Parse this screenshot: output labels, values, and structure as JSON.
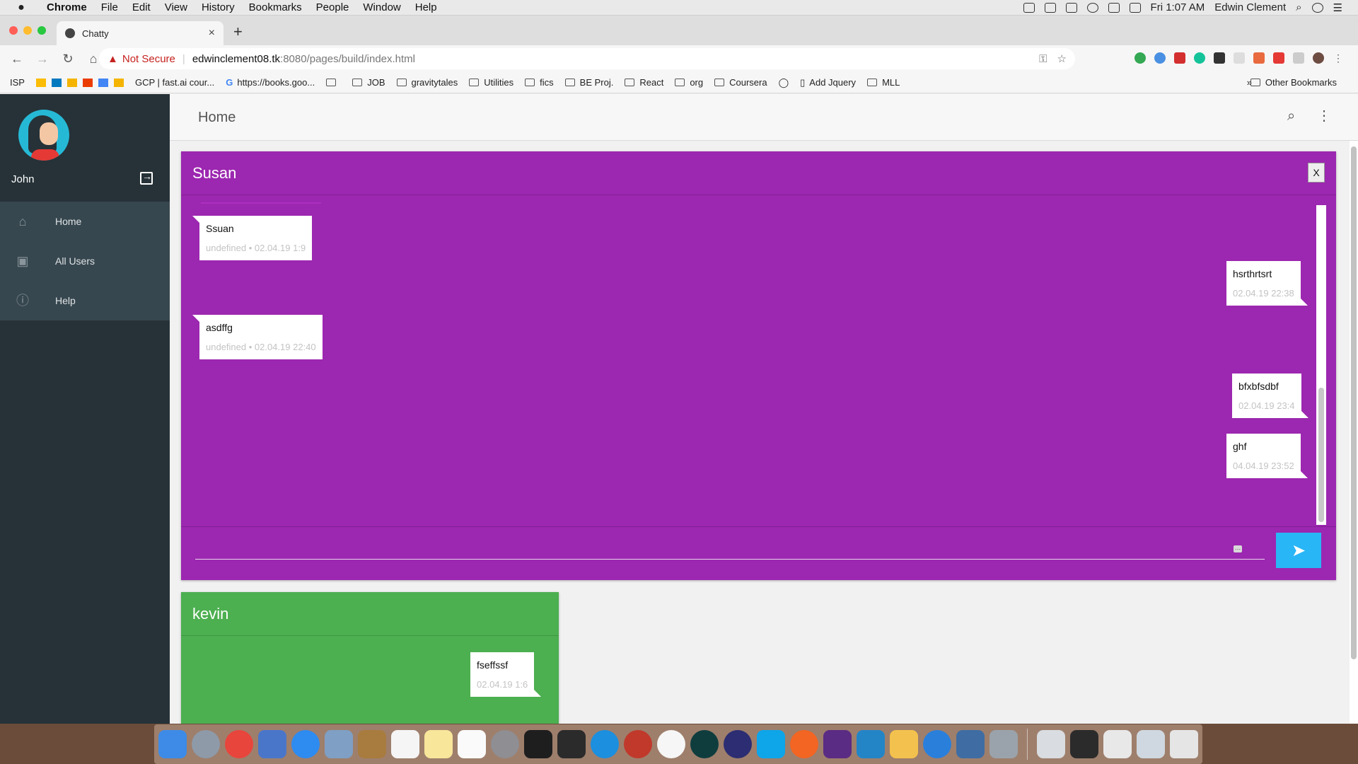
{
  "menubar": {
    "apple": "",
    "items": [
      "Chrome",
      "File",
      "Edit",
      "View",
      "History",
      "Bookmarks",
      "People",
      "Window",
      "Help"
    ],
    "clock": "Fri 1:07 AM",
    "user": "Edwin Clement"
  },
  "browser": {
    "tab_title": "Chatty",
    "tab_close": "×",
    "new_tab": "+",
    "security_label": "Not Secure",
    "url_host": "edwinclement08.tk",
    "url_path": ":8080/pages/build/index.html"
  },
  "bookmarks": {
    "items": [
      "ISP",
      "GCP | fast.ai cour...",
      "https://books.goo...",
      "JOB",
      "gravitytales",
      "Utilities",
      "fics",
      "BE Proj.",
      "React",
      "org",
      "Coursera",
      "Add Jquery",
      "MLL"
    ],
    "overflow": "»",
    "other": "Other Bookmarks"
  },
  "sidebar": {
    "username": "John",
    "nav": [
      {
        "label": "Home",
        "icon": "home-icon"
      },
      {
        "label": "All Users",
        "icon": "inbox-icon"
      },
      {
        "label": "Help",
        "icon": "help-icon"
      }
    ]
  },
  "header": {
    "title": "Home"
  },
  "chats": {
    "susan": {
      "name": "Susan",
      "close_label": "X",
      "color": "#9c27b0",
      "messages": [
        {
          "text": "Ssuan",
          "meta": "undefined • 02.04.19 1:9",
          "side": "left"
        },
        {
          "text": "hsrthrtsrt",
          "meta": "02.04.19 22:38",
          "side": "right"
        },
        {
          "text": "asdffg",
          "meta": "undefined • 02.04.19 22:40",
          "side": "left"
        },
        {
          "text": "bfxbfsdbf",
          "meta": "02.04.19 23:4",
          "side": "right"
        },
        {
          "text": "ghf",
          "meta": "04.04.19 23:52",
          "side": "right"
        }
      ],
      "input_value": "",
      "send_icon": "send-icon"
    },
    "kevin": {
      "name": "kevin",
      "color": "#4caf50",
      "messages": [
        {
          "text": "fseffssf",
          "meta": "02.04.19 1:6",
          "side": "right"
        }
      ]
    }
  }
}
